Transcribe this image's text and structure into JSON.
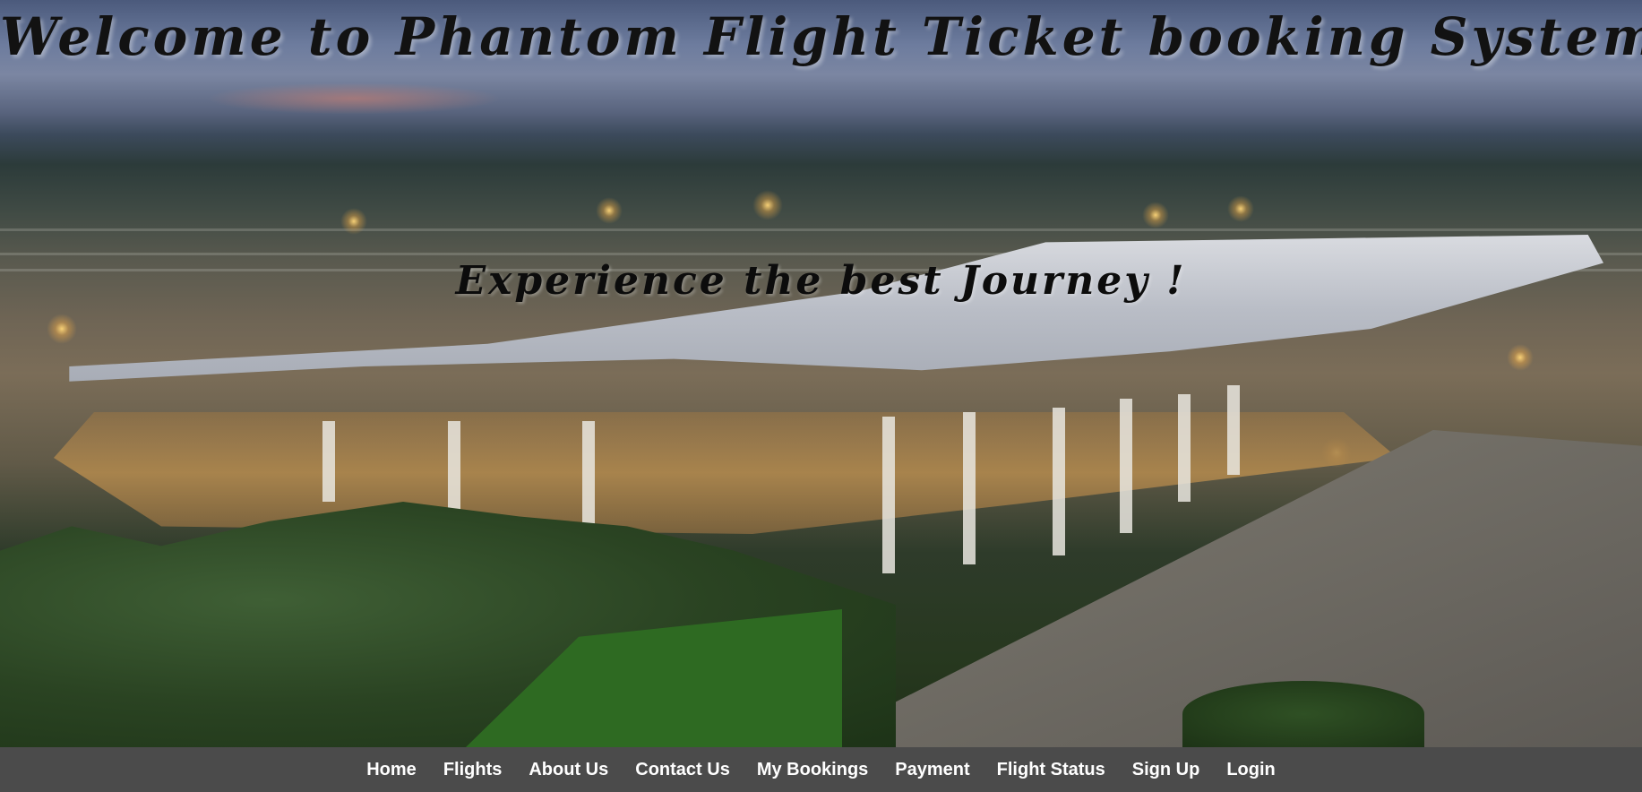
{
  "header": {
    "title": "Welcome to Phantom Flight Ticket booking System",
    "tagline": "Experience the best Journey !"
  },
  "nav": {
    "items": [
      {
        "label": "Home"
      },
      {
        "label": "Flights"
      },
      {
        "label": "About Us"
      },
      {
        "label": "Contact Us"
      },
      {
        "label": "My Bookings"
      },
      {
        "label": "Payment"
      },
      {
        "label": "Flight Status"
      },
      {
        "label": "Sign Up"
      },
      {
        "label": "Login"
      }
    ]
  },
  "colors": {
    "navbar_background": "#4b4b4b",
    "nav_text": "#ffffff",
    "title_text": "#121212"
  }
}
